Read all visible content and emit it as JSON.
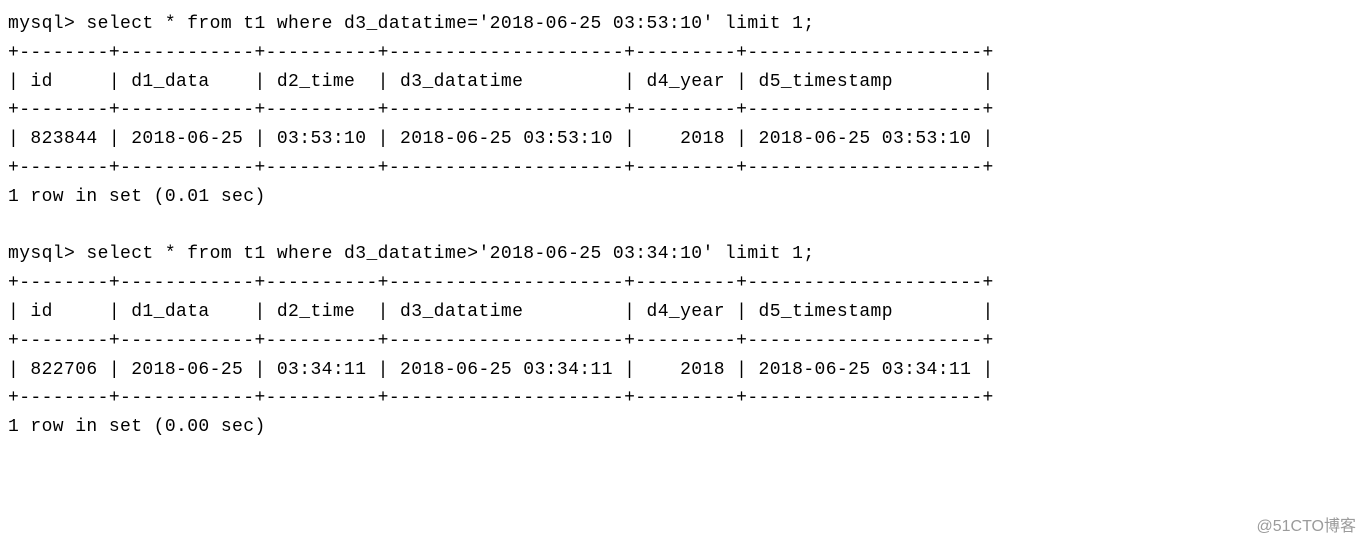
{
  "query1": {
    "prompt": "mysql> select * from t1 where d3_datatime='2018-06-25 03:53:10' limit 1;",
    "rule": "+--------+------------+----------+---------------------+---------+---------------------+",
    "header": "| id     | d1_data    | d2_time  | d3_datatime         | d4_year | d5_timestamp        |",
    "row": "| 823844 | 2018-06-25 | 03:53:10 | 2018-06-25 03:53:10 |    2018 | 2018-06-25 03:53:10 |",
    "footer": "1 row in set (0.01 sec)"
  },
  "query2": {
    "prompt": "mysql> select * from t1 where d3_datatime>'2018-06-25 03:34:10' limit 1;",
    "rule": "+--------+------------+----------+---------------------+---------+---------------------+",
    "header": "| id     | d1_data    | d2_time  | d3_datatime         | d4_year | d5_timestamp        |",
    "row": "| 822706 | 2018-06-25 | 03:34:11 | 2018-06-25 03:34:11 |    2018 | 2018-06-25 03:34:11 |",
    "footer": "1 row in set (0.00 sec)"
  },
  "watermark": "@51CTO博客"
}
